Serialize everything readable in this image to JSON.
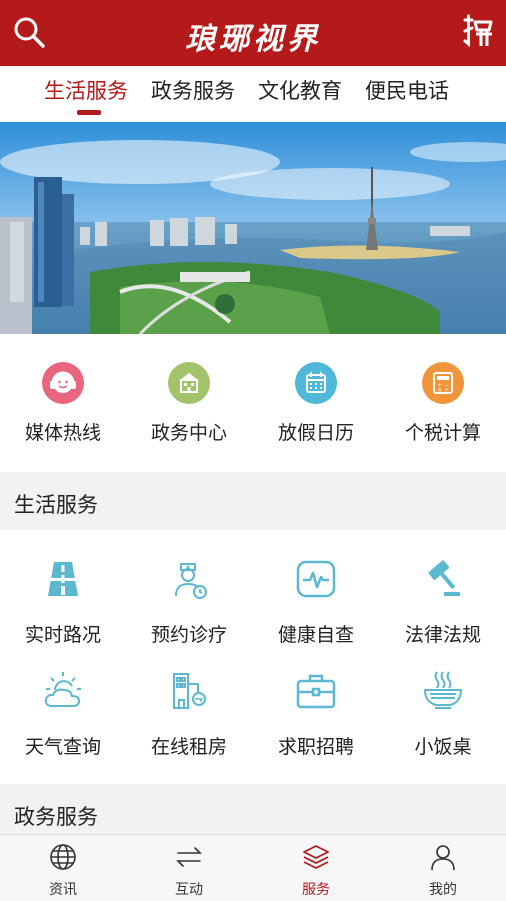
{
  "header": {
    "title": "琅琊视界",
    "search_icon": "search-icon",
    "newspaper_icon": "newspaper-icon"
  },
  "tabs": [
    {
      "label": "生活服务",
      "active": true
    },
    {
      "label": "政务服务",
      "active": false
    },
    {
      "label": "文化教育",
      "active": false
    },
    {
      "label": "便民电话",
      "active": false
    }
  ],
  "quick": [
    {
      "label": "媒体热线",
      "icon": "headset-icon",
      "color": "#e9667e"
    },
    {
      "label": "政务中心",
      "icon": "building-icon",
      "color": "#a3c36a"
    },
    {
      "label": "放假日历",
      "icon": "calendar-icon",
      "color": "#4fb7d8"
    },
    {
      "label": "个税计算",
      "icon": "calculator-icon",
      "color": "#f0953a"
    }
  ],
  "sections": {
    "life": "生活服务",
    "gov": "政务服务"
  },
  "services": [
    {
      "label": "实时路况",
      "icon": "road-icon"
    },
    {
      "label": "预约诊疗",
      "icon": "doctor-icon"
    },
    {
      "label": "健康自查",
      "icon": "heartbeat-icon"
    },
    {
      "label": "法律法规",
      "icon": "gavel-icon"
    },
    {
      "label": "天气查询",
      "icon": "weather-icon"
    },
    {
      "label": "在线租房",
      "icon": "house-key-icon"
    },
    {
      "label": "求职招聘",
      "icon": "briefcase-icon"
    },
    {
      "label": "小饭桌",
      "icon": "bowl-icon"
    }
  ],
  "icon_color": "#5bb8cf",
  "brand_color": "#b51a1a",
  "nav": [
    {
      "label": "资讯",
      "icon": "globe-icon",
      "active": false
    },
    {
      "label": "互动",
      "icon": "arrows-icon",
      "active": false
    },
    {
      "label": "服务",
      "icon": "layers-icon",
      "active": true
    },
    {
      "label": "我的",
      "icon": "person-icon",
      "active": false
    }
  ]
}
